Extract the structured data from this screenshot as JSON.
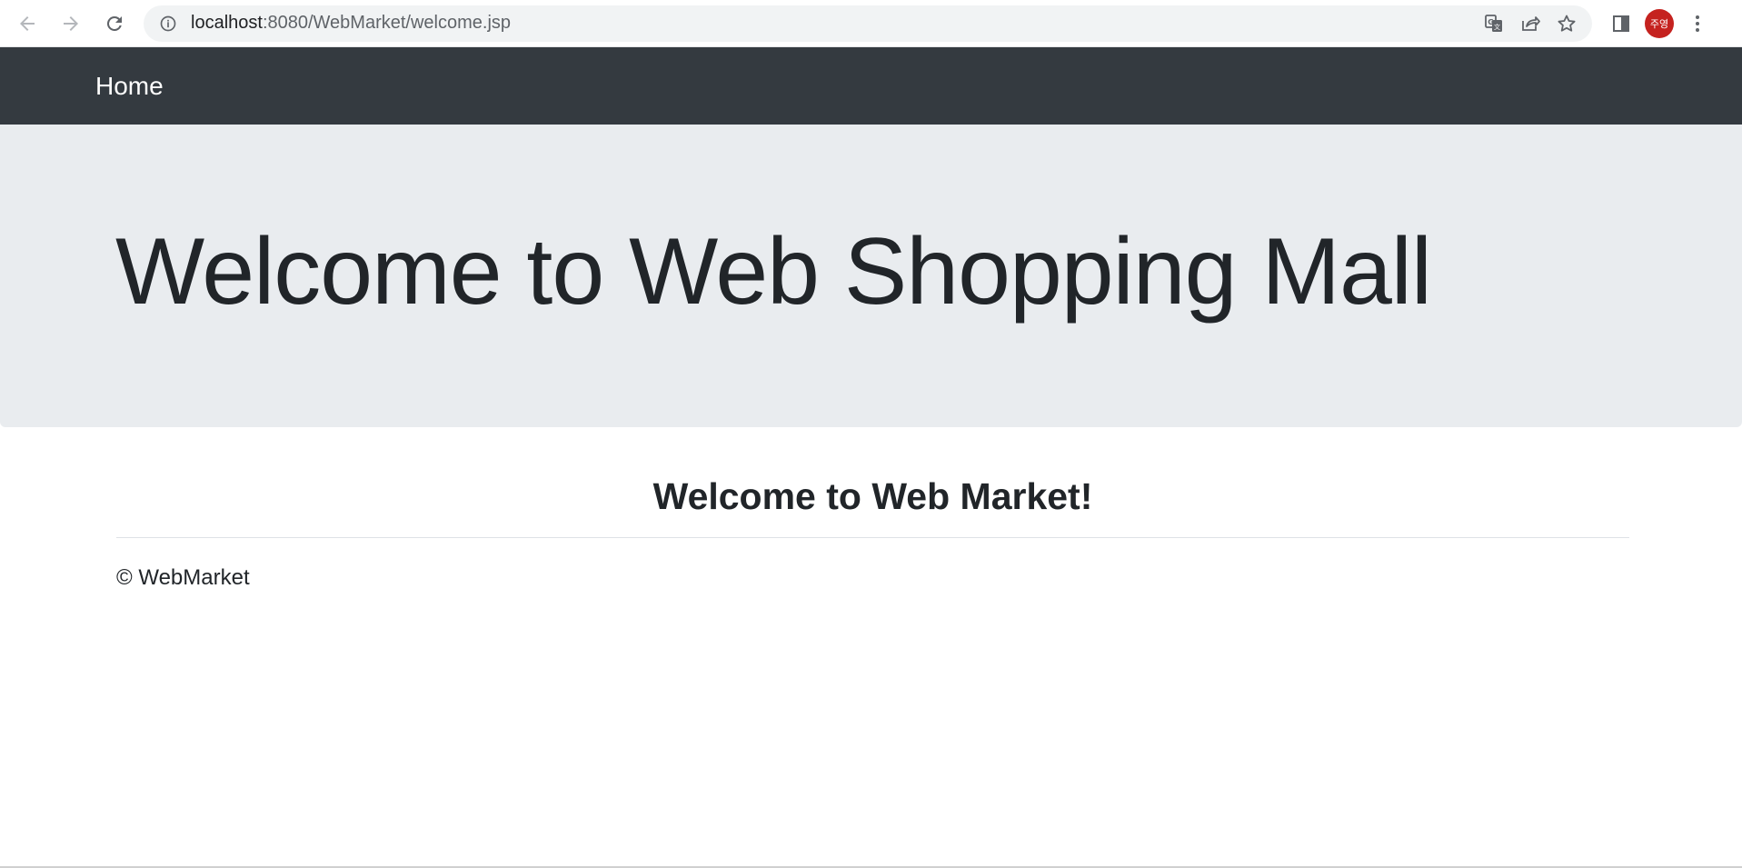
{
  "browser": {
    "url_host": "localhost",
    "url_path": ":8080/WebMarket/welcome.jsp",
    "profile_initials": "주영",
    "profile_color": "#c5221f",
    "icons": [
      "back-icon",
      "forward-icon",
      "reload-icon",
      "info-icon",
      "translate-icon",
      "share-icon",
      "star-icon",
      "side-panel-icon",
      "more-icon"
    ]
  },
  "navbar": {
    "brand": "Home",
    "background": "#343a40"
  },
  "jumbotron": {
    "title": "Welcome to Web Shopping Mall",
    "background": "#e9ecef"
  },
  "main": {
    "greeting": "Welcome to Web Market!"
  },
  "footer": {
    "text": "© WebMarket"
  }
}
